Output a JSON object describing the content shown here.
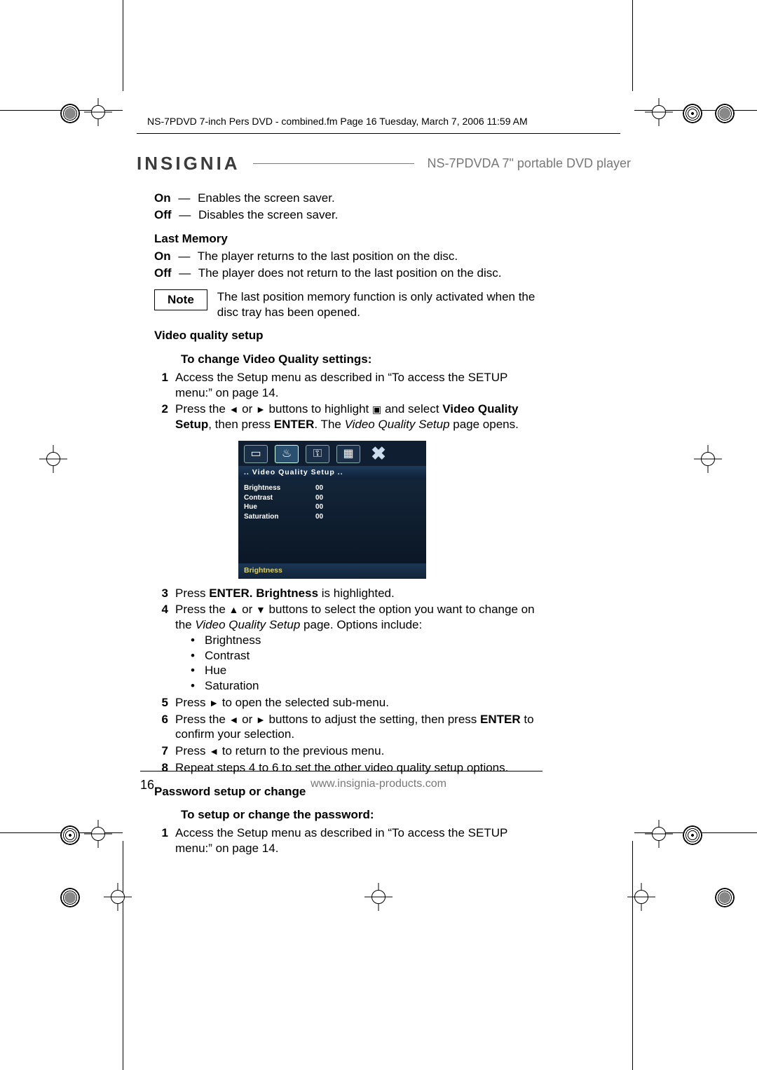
{
  "fm_header": "NS-7PDVD 7-inch Pers DVD - combined.fm  Page 16  Tuesday, March 7, 2006  11:59 AM",
  "brand": "INSIGNIA",
  "product": "NS-7PDVDA 7\" portable DVD player",
  "ss": {
    "on_label": "On",
    "on_text": "Enables the screen saver.",
    "off_label": "Off",
    "off_text": "Disables the screen saver."
  },
  "lastmem": {
    "heading": "Last Memory",
    "on_label": "On",
    "on_text": "The player returns to the last position on the disc.",
    "off_label": "Off",
    "off_text": "The player does not return to the last position on the disc."
  },
  "note_label": "Note",
  "note_text": "The last position memory function is only activated when the disc tray has been opened.",
  "vq": {
    "heading": "Video quality setup",
    "subheading": "To change Video Quality settings:",
    "step1": "Access the Setup menu as described in “To access the SETUP menu:” on page 14.",
    "step2_a": "Press the ",
    "step2_b": " or ",
    "step2_c": " buttons to highlight ",
    "step2_d": " and select ",
    "step2_bold1": "Video Quality Setup",
    "step2_e": ", then press ",
    "step2_bold2": "ENTER",
    "step2_f": ". The ",
    "step2_it": "Video Quality Setup",
    "step2_g": " page opens.",
    "osd_title": "..   Video  Quality  Setup   ..",
    "osd_rows": [
      {
        "k": "Brightness",
        "v": "00"
      },
      {
        "k": "Contrast",
        "v": "00"
      },
      {
        "k": "Hue",
        "v": "00"
      },
      {
        "k": "Saturation",
        "v": "00"
      }
    ],
    "osd_foot": "Brightness",
    "step3_a": "Press ",
    "step3_bold": "ENTER. Brightness",
    "step3_b": " is highlighted.",
    "step4_a": "Press the ",
    "step4_b": " or ",
    "step4_c": " buttons to select the option you want to change on the ",
    "step4_it": "Video Quality Setup",
    "step4_d": " page. Options include:",
    "step4_opts": [
      "Brightness",
      "Contrast",
      "Hue",
      "Saturation"
    ],
    "step5_a": "Press ",
    "step5_b": " to open the selected sub-menu.",
    "step6_a": "Press the ",
    "step6_b": " or ",
    "step6_c": " buttons to adjust the setting, then press ",
    "step6_bold": "ENTER",
    "step6_d": " to confirm your selection.",
    "step7_a": "Press ",
    "step7_b": " to return to the previous menu.",
    "step8": "Repeat steps 4 to 6 to set the other video quality setup options."
  },
  "pw": {
    "heading": "Password setup or change",
    "subheading": "To setup or change the password:",
    "step1": "Access the Setup menu as described in “To access the SETUP menu:” on page 14."
  },
  "page_number": "16",
  "footer_url": "www.insignia-products.com",
  "icons": {
    "left": "◄",
    "right": "►",
    "up": "▲",
    "down": "▼",
    "video": "▣",
    "em_dash": "—"
  },
  "osd_tab_syms": [
    "▭",
    "♨",
    "⚿",
    "▦",
    "✖"
  ]
}
